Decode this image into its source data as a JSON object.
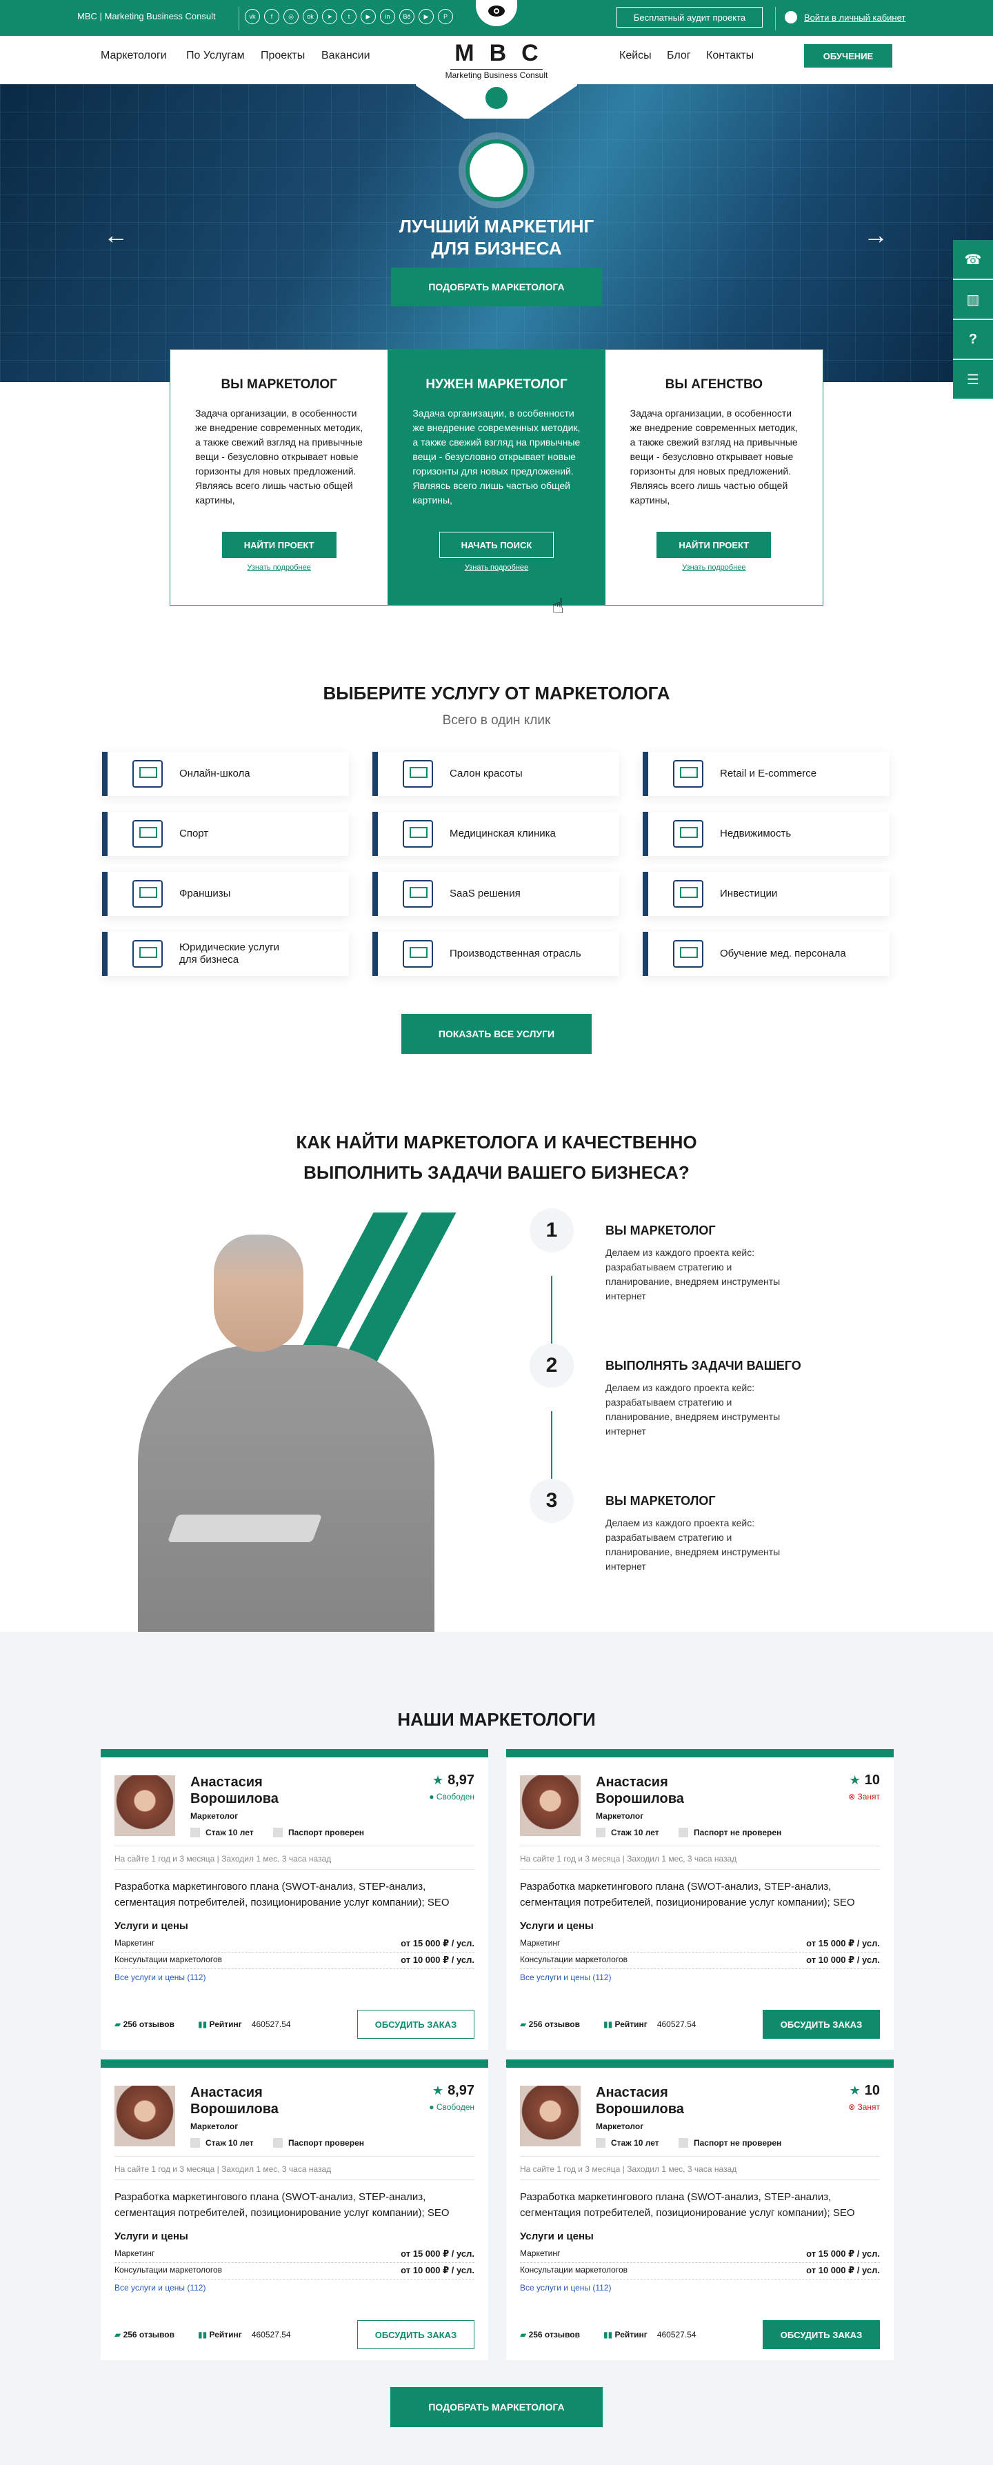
{
  "topbar": {
    "brand": "MBC | Marketing Business Consult",
    "socials": [
      "vk",
      "f",
      "ig",
      "ok",
      "tg",
      "tw",
      "yt",
      "in",
      "be",
      "yt2",
      "p"
    ],
    "audit": "Бесплатный аудит проекта",
    "login": "Войти в личный кабинет"
  },
  "nav": {
    "left": [
      "Маркетологи",
      "По Услугам",
      "Проекты",
      "Вакансии"
    ],
    "right": [
      "Кейсы",
      "Блог",
      "Контакты"
    ],
    "logo": "MBC",
    "logo_sub": "Marketing Business Consult",
    "edu": "ОБУЧЕНИЕ"
  },
  "hero": {
    "title": "ЛУЧШИЙ МАРКЕТИНГ",
    "title2": "ДЛЯ БИЗНЕСА",
    "cta": "ПОДОБРАТЬ МАРКЕТОЛОГА"
  },
  "side": [
    "☎",
    "▥",
    "?",
    "☰"
  ],
  "roles": [
    {
      "title": "ВЫ МАРКЕТОЛОГ",
      "text": "Задача организации, в особенности же внедрение современных методик, а также свежий взгляд на привычные вещи - безусловно открывает новые горизонты для новых предложений. Являясь всего лишь частью общей картины,",
      "btn": "НАЙТИ ПРОЕКТ",
      "more": "Узнать подробнее"
    },
    {
      "title": "НУЖЕН МАРКЕТОЛОГ",
      "text": "Задача организации, в особенности же внедрение современных методик, а также свежий взгляд на привычные вещи - безусловно открывает новые горизонты для новых предложений. Являясь всего лишь частью общей картины,",
      "btn": "НАЧАТЬ ПОИСК",
      "more": "Узнать подробнее"
    },
    {
      "title": "ВЫ АГЕНСТВО",
      "text": "Задача организации, в особенности же внедрение современных методик, а также свежий взгляд на привычные вещи - безусловно открывает новые горизонты для новых предложений. Являясь всего лишь частью общей картины,",
      "btn": "НАЙТИ ПРОЕКТ",
      "more": "Узнать подробнее"
    }
  ],
  "services": {
    "title": "ВЫБЕРИТЕ УСЛУГУ ОТ МАРКЕТОЛОГА",
    "subtitle": "Всего в один клик",
    "items": [
      "Онлайн-школа",
      "Салон красоты",
      "Retail и E-commerce",
      "Спорт",
      "Медицинская клиника",
      "Недвижимость",
      "Франшизы",
      "SaaS решения",
      "Инвестиции",
      "Юридические услуги\nдля бизнеса",
      "Производственная отрасль",
      "Обучение мед. персонала"
    ],
    "button": "ПОКАЗАТЬ ВСЕ УСЛУГИ"
  },
  "how": {
    "title": "КАК НАЙТИ МАРКЕТОЛОГА И КАЧЕСТВЕННО",
    "title2": "ВЫПОЛНИТЬ ЗАДАЧИ ВАШЕГО БИЗНЕСА?",
    "steps": [
      {
        "num": "1",
        "title": "ВЫ МАРКЕТОЛОГ",
        "text": "Делаем из каждого проекта кейс: разрабатываем стратегию и планирование, внедряем инструменты интернет"
      },
      {
        "num": "2",
        "title": "ВЫПОЛНЯТЬ ЗАДАЧИ ВАШЕГО",
        "text": "Делаем из каждого проекта кейс: разрабатываем стратегию и планирование, внедряем инструменты интернет"
      },
      {
        "num": "3",
        "title": "ВЫ МАРКЕТОЛОГ",
        "text": "Делаем из каждого проекта кейс: разрабатываем стратегию и планирование, внедряем инструменты интернет"
      }
    ]
  },
  "marketers": {
    "title": "НАШИ МАРКЕТОЛОГИ",
    "cards": [
      {
        "name": "Анастасия Ворошилова",
        "role": "Маркетолог",
        "rating": "8,97",
        "status": "Свободен",
        "exp": "Стаж 10 лет",
        "passport": "Паспорт проверен",
        "seen": "На сайте 1 год и 3 месяца | Заходил 1 мес, 3 часа назад",
        "desc": "Разработка маркетингового плана (SWOT-анализ, STEP-анализ, сегментация потребителей, позиционирование услуг компании); SEO -продвижение: составление и анализ семантического ядра, работа с...",
        "svc_title": "Услуги и цены",
        "svc1": "Маркетинг",
        "price1": "от 15 000 ₽ / усл.",
        "svc2": "Консультации маркетологов",
        "price2": "от 10 000 ₽ / усл.",
        "all": "Все услуги и цены (112)",
        "reviews": "256 отзывов",
        "rating_label": "Рейтинг",
        "rating_val": "460527.54",
        "btn": "ОБСУДИТЬ ЗАКАЗ"
      },
      {
        "name": "Анастасия Ворошилова",
        "role": "Маркетолог",
        "rating": "10",
        "status": "Занят",
        "exp": "Стаж 10 лет",
        "passport": "Паспорт не проверен",
        "seen": "На сайте 1 год и 3 месяца | Заходил 1 мес, 3 часа назад",
        "desc": "Разработка маркетингового плана (SWOT-анализ, STEP-анализ, сегментация потребителей, позиционирование услуг компании); SEO -продвижение: составление и анализ семантического ядра, работа с...",
        "svc_title": "Услуги и цены",
        "svc1": "Маркетинг",
        "price1": "от 15 000 ₽ / усл.",
        "svc2": "Консультации маркетологов",
        "price2": "от 10 000 ₽ / усл.",
        "all": "Все услуги и цены (112)",
        "reviews": "256 отзывов",
        "rating_label": "Рейтинг",
        "rating_val": "460527.54",
        "btn": "ОБСУДИТЬ ЗАКАЗ"
      },
      {
        "name": "Анастасия Ворошилова",
        "role": "Маркетолог",
        "rating": "8,97",
        "status": "Свободен",
        "exp": "Стаж 10 лет",
        "passport": "Паспорт проверен",
        "seen": "На сайте 1 год и 3 месяца | Заходил 1 мес, 3 часа назад",
        "desc": "Разработка маркетингового плана (SWOT-анализ, STEP-анализ, сегментация потребителей, позиционирование услуг компании); SEO -продвижение: составление и анализ семантического ядра, работа с...",
        "svc_title": "Услуги и цены",
        "svc1": "Маркетинг",
        "price1": "от 15 000 ₽ / усл.",
        "svc2": "Консультации маркетологов",
        "price2": "от 10 000 ₽ / усл.",
        "all": "Все услуги и цены (112)",
        "reviews": "256 отзывов",
        "rating_label": "Рейтинг",
        "rating_val": "460527.54",
        "btn": "ОБСУДИТЬ ЗАКАЗ"
      },
      {
        "name": "Анастасия Ворошилова",
        "role": "Маркетолог",
        "rating": "10",
        "status": "Занят",
        "exp": "Стаж 10 лет",
        "passport": "Паспорт не проверен",
        "seen": "На сайте 1 год и 3 месяца | Заходил 1 мес, 3 часа назад",
        "desc": "Разработка маркетингового плана (SWOT-анализ, STEP-анализ, сегментация потребителей, позиционирование услуг компании); SEO -продвижение: составление и анализ семантического ядра, работа с...",
        "svc_title": "Услуги и цены",
        "svc1": "Маркетинг",
        "price1": "от 15 000 ₽ / усл.",
        "svc2": "Консультации маркетологов",
        "price2": "от 10 000 ₽ / усл.",
        "all": "Все услуги и цены (112)",
        "reviews": "256 отзывов",
        "rating_label": "Рейтинг",
        "rating_val": "460527.54",
        "btn": "ОБСУДИТЬ ЗАКАЗ"
      }
    ],
    "button": "ПОДОБРАТЬ МАРКЕТОЛОГА"
  }
}
